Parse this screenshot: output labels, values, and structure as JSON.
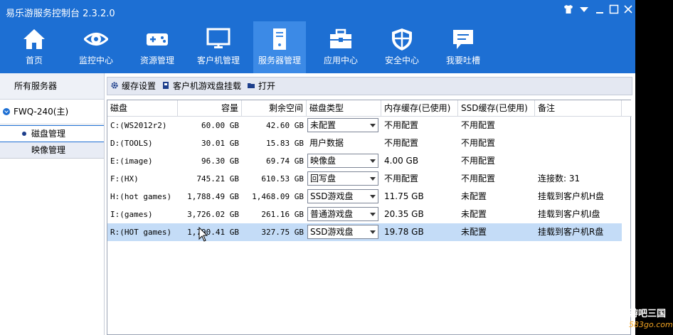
{
  "app": {
    "title": "易乐游服务控制台 2.3.2.0"
  },
  "nav": [
    {
      "label": "首页",
      "icon": "home-icon"
    },
    {
      "label": "监控中心",
      "icon": "eye-icon"
    },
    {
      "label": "资源管理",
      "icon": "gamepad-icon"
    },
    {
      "label": "客户机管理",
      "icon": "monitor-icon"
    },
    {
      "label": "服务器管理",
      "icon": "server-icon",
      "active": true
    },
    {
      "label": "应用中心",
      "icon": "toolbox-icon"
    },
    {
      "label": "安全中心",
      "icon": "shield-icon"
    },
    {
      "label": "我要吐槽",
      "icon": "chat-icon"
    }
  ],
  "sidebar": {
    "all": "所有服务器",
    "server": "FWQ-240(主)",
    "items": [
      "磁盘管理",
      "映像管理"
    ]
  },
  "toolbar": {
    "cache": "缓存设置",
    "mount": "客户机游戏盘挂载",
    "open": "打开"
  },
  "table": {
    "headers": [
      "磁盘",
      "容量",
      "剩余空间",
      "磁盘类型",
      "内存缓存(已使用)",
      "SSD缓存(已使用)",
      "备注"
    ],
    "rows": [
      {
        "disk": "C:(WS2012r2)",
        "cap": "60.00 GB",
        "free": "42.60 GB",
        "type": "未配置",
        "select": true,
        "mem": "不用配置",
        "ssd": "不用配置",
        "note": ""
      },
      {
        "disk": "D:(TOOLS)",
        "cap": "30.01 GB",
        "free": "15.83 GB",
        "type": "用户数据",
        "select": false,
        "mem": "不用配置",
        "ssd": "不用配置",
        "note": ""
      },
      {
        "disk": "E:(image)",
        "cap": "96.30 GB",
        "free": "69.74 GB",
        "type": "映像盘",
        "select": true,
        "mem": "4.00 GB",
        "ssd": "不用配置",
        "note": ""
      },
      {
        "disk": "F:(HX)",
        "cap": "745.21 GB",
        "free": "610.53 GB",
        "type": "回写盘",
        "select": true,
        "mem": "不用配置",
        "ssd": "不用配置",
        "note": "连接数: 31"
      },
      {
        "disk": "H:(hot games)",
        "cap": "1,788.49 GB",
        "free": "1,468.09 GB",
        "type": "SSD游戏盘",
        "select": true,
        "mem": "11.75 GB",
        "ssd": "未配置",
        "note": "挂载到客户机H盘"
      },
      {
        "disk": "I:(games)",
        "cap": "3,726.02 GB",
        "free": "261.16 GB",
        "type": "普通游戏盘",
        "select": true,
        "mem": "20.35 GB",
        "ssd": "未配置",
        "note": "挂载到客户机I盘"
      },
      {
        "disk": "R:(HOT games)",
        "cap": "1,790.41 GB",
        "free": "327.75 GB",
        "type": "SSD游戏盘",
        "select": true,
        "mem": "19.78 GB",
        "ssd": "未配置",
        "note": "挂载到客户机R盘",
        "selected": true
      }
    ]
  },
  "watermark": {
    "line1": "游吧三国",
    "line2": "583go.com"
  },
  "colors": {
    "accent": "#1d6fd3",
    "active_nav": "#3c8ae6",
    "row_selected": "#c4dcf7"
  }
}
